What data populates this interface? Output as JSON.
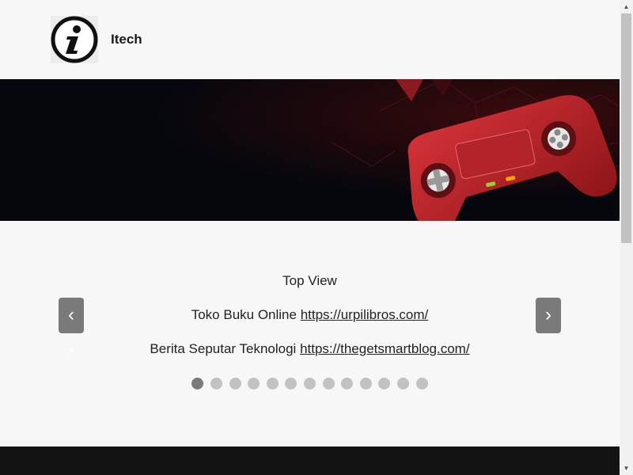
{
  "header": {
    "site_title": "Itech",
    "logo_icon": "info-icon"
  },
  "banner": {
    "image": "gaming-controller-icon",
    "colors": {
      "background": "#06070d",
      "accent": "#c4282d"
    }
  },
  "slider": {
    "title": "Top View",
    "lines": [
      {
        "text": "Toko Buku Online",
        "link": "https://urpilibros.com/"
      },
      {
        "text": "Berita Seputar Teknologi",
        "link": "https://thegetsmartblog.com/"
      }
    ],
    "prev_label": "‹",
    "next_label": "›",
    "dot_count": 13,
    "active_dot": 1
  },
  "scrollbar": {
    "up_icon": "scroll-up-arrow-icon",
    "down_icon": "scroll-down-arrow-icon",
    "up_glyph": "▲",
    "down_glyph": "▼"
  }
}
